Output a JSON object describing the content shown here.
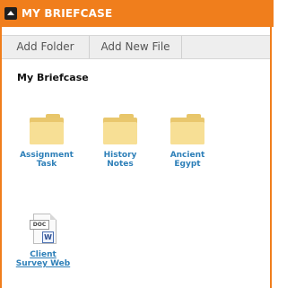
{
  "header": {
    "title": "MY BRIEFCASE",
    "icon": "eject-icon"
  },
  "toolbar": {
    "add_folder": "Add Folder",
    "add_new_file": "Add New File"
  },
  "section": {
    "title": "My Briefcase"
  },
  "items": [
    {
      "label_line1": "Assignment",
      "label_line2": "Task",
      "icon": "folder-icon"
    },
    {
      "label_line1": "History",
      "label_line2": "Notes",
      "icon": "folder-icon"
    },
    {
      "label_line1": "Ancient",
      "label_line2": "Egypt",
      "icon": "folder-icon"
    }
  ],
  "file": {
    "label_line1": "Client",
    "label_line2": "Survey Web",
    "badge": "DOC",
    "app_letter": "W",
    "icon": "word-document-icon"
  },
  "colors": {
    "accent": "#f07e1c",
    "link": "#2d7fb8",
    "folder": "#f7df95"
  }
}
